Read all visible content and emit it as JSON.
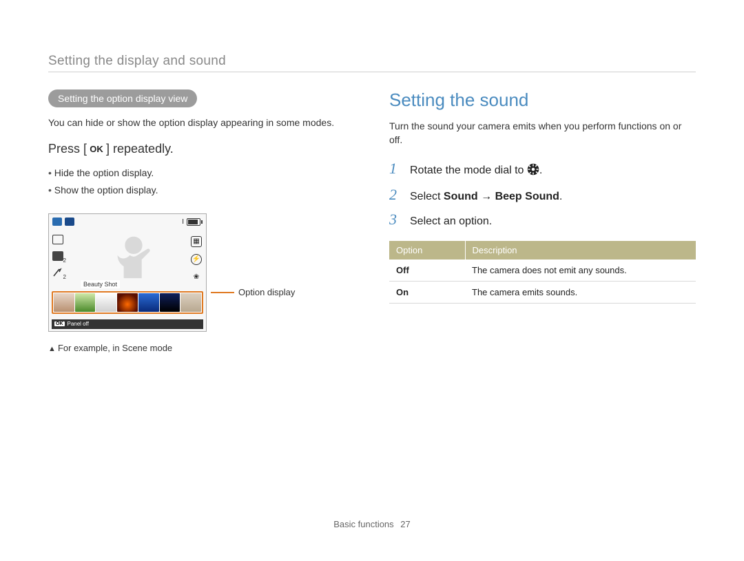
{
  "header": {
    "title": "Setting the display and sound"
  },
  "left": {
    "pill": "Setting the option display view",
    "intro": "You can hide or show the option display appearing in some modes.",
    "press_prefix": "Press [",
    "press_suffix": "] repeatedly.",
    "ok_label": "OK",
    "bullets": [
      "Hide the option display.",
      "Show the option display."
    ],
    "screenshot": {
      "beauty_label": "Beauty Shot",
      "panel_off_btn": "OK",
      "panel_off_label": "Panel off",
      "top_right_value": "I"
    },
    "callout": "Option display",
    "example_note": "For example, in Scene mode"
  },
  "right": {
    "heading": "Setting the sound",
    "intro": "Turn the sound your camera emits when you perform functions on or off.",
    "steps": [
      {
        "num": "1",
        "prefix": "Rotate the mode dial to ",
        "suffix": "."
      },
      {
        "num": "2",
        "prefix": "Select ",
        "bold1": "Sound",
        "arrow": " → ",
        "bold2": "Beep Sound",
        "suffix": "."
      },
      {
        "num": "3",
        "text": "Select an option."
      }
    ],
    "table": {
      "headers": [
        "Option",
        "Description"
      ],
      "rows": [
        {
          "opt": "Off",
          "desc": "The camera does not emit any sounds."
        },
        {
          "opt": "On",
          "desc": "The camera emits sounds."
        }
      ]
    }
  },
  "footer": {
    "section": "Basic functions",
    "page": "27"
  }
}
